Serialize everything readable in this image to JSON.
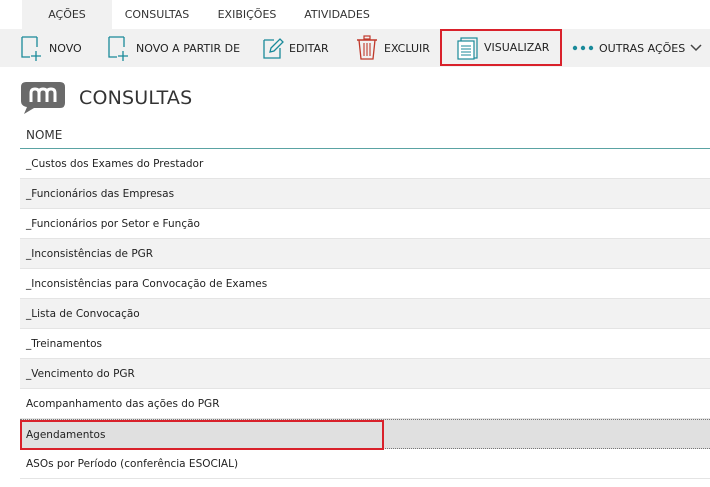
{
  "tabs": [
    {
      "label": "AÇÕES",
      "active": true
    },
    {
      "label": "CONSULTAS",
      "active": false
    },
    {
      "label": "EXIBIÇÕES",
      "active": false
    },
    {
      "label": "ATIVIDADES",
      "active": false
    }
  ],
  "toolbar": {
    "novo": {
      "label": "NOVO",
      "icon": "new-document-icon"
    },
    "novo_partir": {
      "label": "NOVO A PARTIR DE",
      "icon": "new-from-icon"
    },
    "editar": {
      "label": "EDITAR",
      "icon": "edit-pencil-icon"
    },
    "excluir": {
      "label": "EXCLUIR",
      "icon": "trash-icon"
    },
    "visualizar": {
      "label": "VISUALIZAR",
      "icon": "view-list-icon"
    },
    "outras": {
      "label": "OUTRAS AÇÕES",
      "icon": "more-dots-icon"
    }
  },
  "header": {
    "title": "CONSULTAS",
    "logo_color": "#6a6a6a"
  },
  "table": {
    "column": "NOME",
    "rows": [
      "_Custos dos Exames do Prestador",
      "_Funcionários das Empresas",
      "_Funcionários por Setor e Função",
      "_Inconsistências de PGR",
      "_Inconsistências para Convocação de Exames",
      "_Lista de Convocação",
      "_Treinamentos",
      "_Vencimento do PGR",
      "Acompanhamento das ações do PGR",
      "Agendamentos",
      "ASOs por Período (conferência ESOCIAL)"
    ],
    "selected_index": 9
  },
  "colors": {
    "accent": "#1a8a9a",
    "highlight_border": "#d9212b",
    "header_line": "#5aa3a3",
    "delete_red": "#c0392b"
  }
}
